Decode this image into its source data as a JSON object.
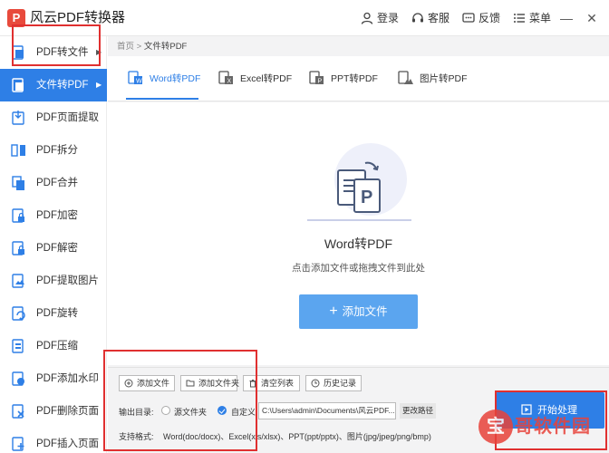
{
  "app": {
    "title": "风云PDF转换器",
    "logo_glyph": "P",
    "accent": "#2e7fe6"
  },
  "titlebar": {
    "login": "登录",
    "service": "客服",
    "feedback": "反馈",
    "menu": "菜单",
    "minimize": "—",
    "close": "✕"
  },
  "sidebar": {
    "items": [
      {
        "label": "PDF转文件",
        "arrow": "▶"
      },
      {
        "label": "文件转PDF",
        "arrow": "▶"
      },
      {
        "label": "PDF页面提取"
      },
      {
        "label": "PDF拆分"
      },
      {
        "label": "PDF合并"
      },
      {
        "label": "PDF加密"
      },
      {
        "label": "PDF解密"
      },
      {
        "label": "PDF提取图片"
      },
      {
        "label": "PDF旋转"
      },
      {
        "label": "PDF压缩"
      },
      {
        "label": "PDF添加水印"
      },
      {
        "label": "PDF删除页面"
      },
      {
        "label": "PDF插入页面"
      }
    ]
  },
  "breadcrumb": {
    "home": "首页",
    "sep": ">",
    "current": "文件转PDF"
  },
  "tabs": [
    {
      "label": "Word转PDF"
    },
    {
      "label": "Excel转PDF"
    },
    {
      "label": "PPT转PDF"
    },
    {
      "label": "图片转PDF"
    }
  ],
  "drop": {
    "title": "Word转PDF",
    "hint": "点击添加文件或拖拽文件到此处",
    "add_plus": "+",
    "add_label": "添加文件"
  },
  "bottom": {
    "buttons": {
      "add_file": "添加文件",
      "add_folder": "添加文件夹",
      "clear": "清空列表",
      "history": "历史记录"
    },
    "output_label": "输出目录:",
    "source_folder": "源文件夹",
    "custom": "自定义",
    "path": "C:\\Users\\admin\\Documents\\风云PDF...",
    "change_path": "更改路径",
    "formats_label": "支持格式:",
    "formats_value": "Word(doc/docx)、Excel(xls/xlsx)、PPT(ppt/pptx)、图片(jpg/jpeg/png/bmp)",
    "start_label": "开始处理"
  },
  "watermark": {
    "badge": "宝",
    "text": "哥软件园"
  }
}
